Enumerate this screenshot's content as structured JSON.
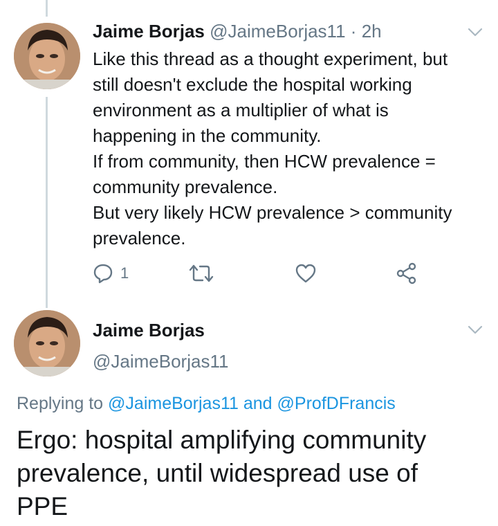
{
  "tweet1": {
    "author_name": "Jaime Borjas",
    "handle": "@JaimeBorjas11",
    "separator": "·",
    "time": "2h",
    "lines": [
      "Like this thread as a thought experiment, but",
      "still doesn't exclude the hospital working",
      "environment as a multiplier of what is",
      "happening in the community.",
      "If from community, then HCW prevalence =",
      "community prevalence.",
      "But very likely HCW prevalence > community",
      "prevalence."
    ],
    "actions": {
      "reply_count": "1",
      "icons": [
        "reply-icon",
        "retweet-icon",
        "like-icon",
        "share-icon"
      ]
    }
  },
  "tweet2": {
    "author_name": "Jaime Borjas",
    "handle": "@JaimeBorjas11",
    "replying_prefix": "Replying to",
    "replying_mention1": "@JaimeBorjas11",
    "replying_and": "and",
    "replying_mention2": "@ProfDFrancis",
    "lines": [
      "Ergo: hospital amplifying community",
      "prevalence, until widespread use of",
      "PPE"
    ]
  },
  "colors": {
    "secondary_text": "#657786",
    "link": "#1b95e0",
    "thread_line": "#cfd9de",
    "primary_text": "#14171a"
  }
}
